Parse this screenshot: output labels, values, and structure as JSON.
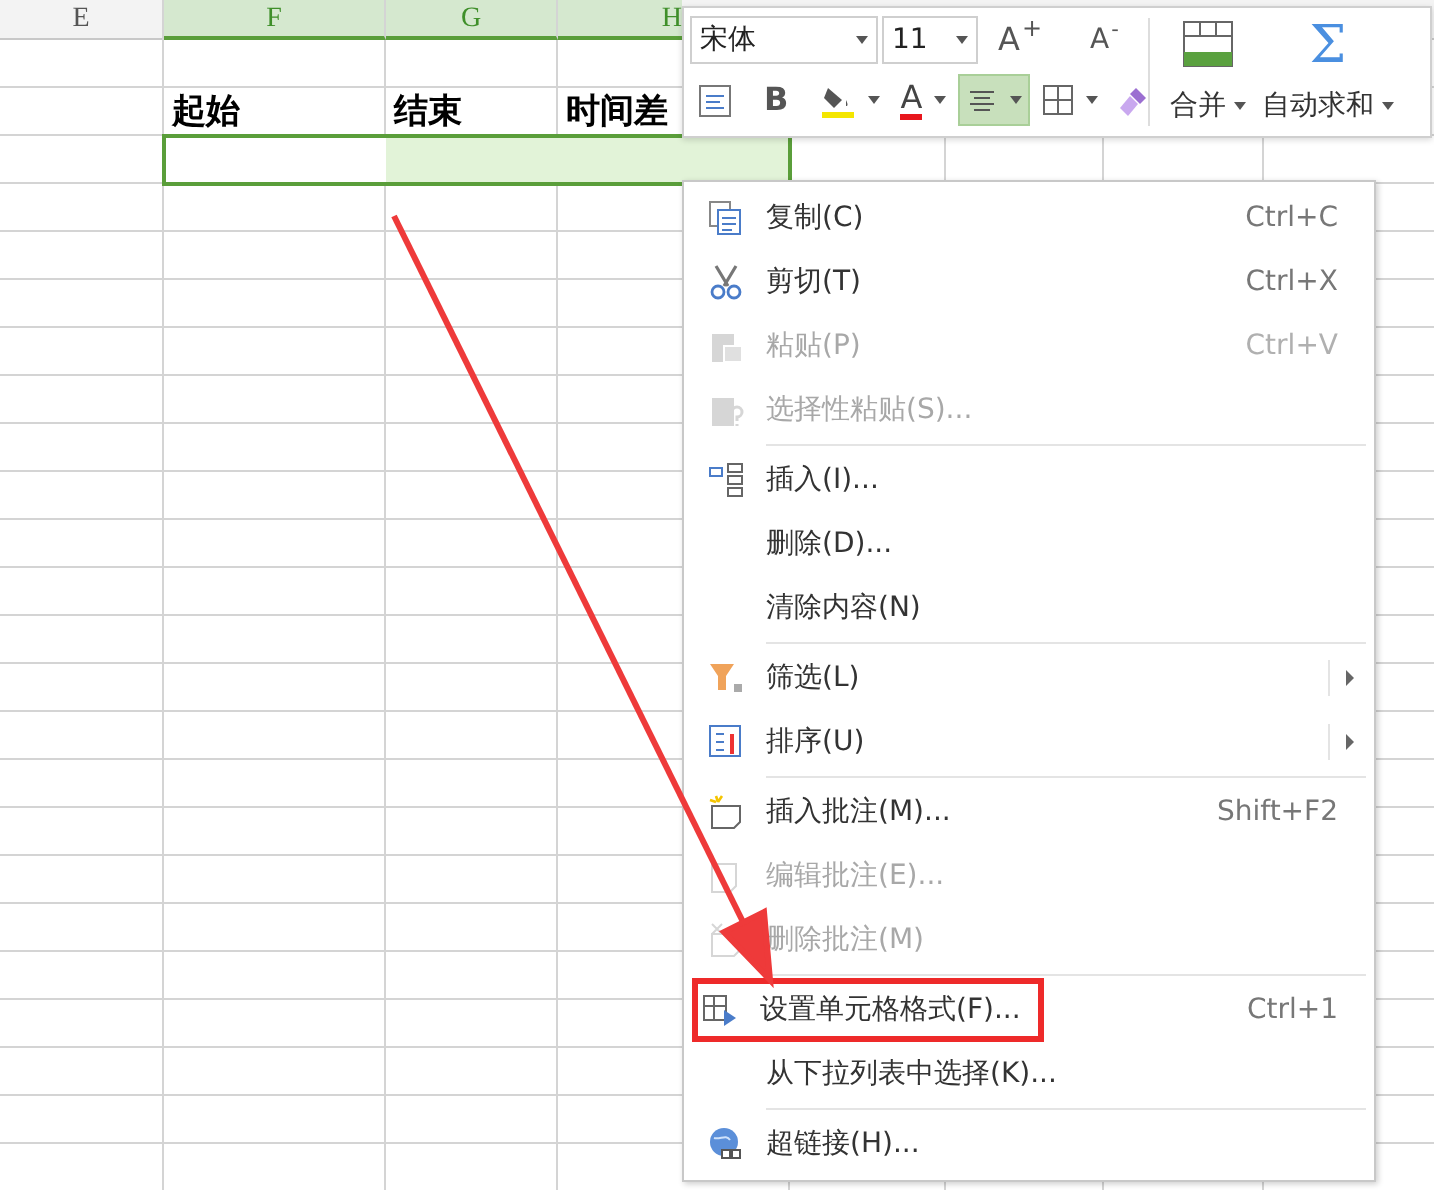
{
  "sheet": {
    "columns": [
      {
        "label": "E",
        "selected": false
      },
      {
        "label": "F",
        "selected": true
      },
      {
        "label": "G",
        "selected": true
      },
      {
        "label": "H",
        "selected": true
      }
    ],
    "header_cells": [
      "起始",
      "结束",
      "时间差"
    ]
  },
  "mini_toolbar": {
    "font": "宋体",
    "size": "11",
    "grow": "A$^{+}$",
    "shrink": "A$^{-}$",
    "tools": [
      {
        "kind": "wrap",
        "dropdown": false,
        "selected": false
      },
      {
        "kind": "bold",
        "label": "B",
        "dropdown": false,
        "selected": false
      },
      {
        "kind": "fill",
        "dropdown": true,
        "selected": false
      },
      {
        "kind": "font_color",
        "label": "A",
        "dropdown": true,
        "selected": false
      },
      {
        "kind": "align",
        "dropdown": true,
        "selected": true
      },
      {
        "kind": "borders",
        "dropdown": true,
        "selected": false
      },
      {
        "kind": "painter",
        "dropdown": false,
        "selected": false
      }
    ],
    "big_buttons": [
      {
        "kind": "merge",
        "label": "合并"
      },
      {
        "kind": "autosum",
        "symbol": "Σ",
        "label": "自动求和"
      }
    ]
  },
  "context_menu": {
    "items": [
      {
        "label": "复制(C)",
        "shortcut": "Ctrl+C",
        "disabled": false,
        "submenu": false,
        "highlighted": false,
        "separator_before": false
      },
      {
        "label": "剪切(T)",
        "shortcut": "Ctrl+X",
        "disabled": false,
        "submenu": false,
        "highlighted": false,
        "separator_before": false
      },
      {
        "label": "粘贴(P)",
        "shortcut": "Ctrl+V",
        "disabled": true,
        "submenu": false,
        "highlighted": false,
        "separator_before": false
      },
      {
        "label": "选择性粘贴(S)...",
        "disabled": true,
        "submenu": false,
        "highlighted": false,
        "separator_before": false
      },
      {
        "label": "插入(I)...",
        "disabled": false,
        "submenu": false,
        "highlighted": false,
        "separator_before": true
      },
      {
        "label": "删除(D)...",
        "disabled": false,
        "submenu": false,
        "highlighted": false,
        "separator_before": false
      },
      {
        "label": "清除内容(N)",
        "disabled": false,
        "submenu": false,
        "highlighted": false,
        "separator_before": false
      },
      {
        "label": "筛选(L)",
        "disabled": false,
        "submenu": true,
        "highlighted": false,
        "separator_before": true
      },
      {
        "label": "排序(U)",
        "disabled": false,
        "submenu": true,
        "highlighted": false,
        "separator_before": false
      },
      {
        "label": "插入批注(M)...",
        "shortcut": "Shift+F2",
        "disabled": false,
        "submenu": false,
        "highlighted": false,
        "separator_before": true
      },
      {
        "label": "编辑批注(E)...",
        "disabled": true,
        "submenu": false,
        "highlighted": false,
        "separator_before": false
      },
      {
        "label": "删除批注(M)",
        "disabled": true,
        "submenu": false,
        "highlighted": false,
        "separator_before": false
      },
      {
        "label": "设置单元格格式(F)...",
        "shortcut": "Ctrl+1",
        "disabled": false,
        "submenu": false,
        "highlighted": true,
        "separator_before": true
      },
      {
        "label": "从下拉列表中选择(K)...",
        "disabled": false,
        "submenu": false,
        "highlighted": false,
        "separator_before": false
      },
      {
        "label": "超链接(H)...",
        "disabled": false,
        "submenu": false,
        "highlighted": false,
        "separator_before": true
      }
    ]
  },
  "annotations": [
    {
      "kind": "arrow"
    }
  ]
}
